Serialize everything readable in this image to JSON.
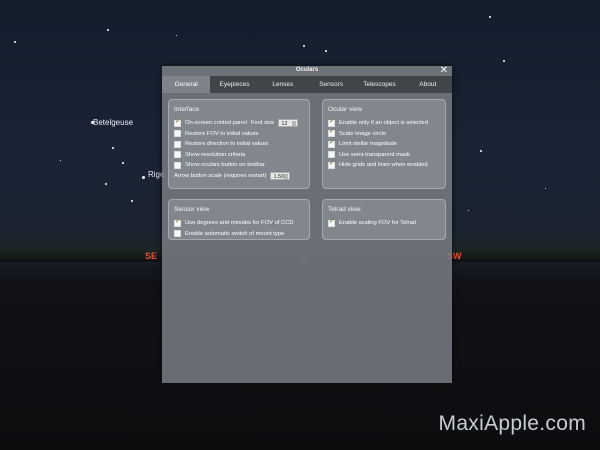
{
  "dialog": {
    "title": "Oculars",
    "close_glyph": "✕",
    "tabs": [
      "General",
      "Eyepieces",
      "Lenses",
      "Sensors",
      "Telescopes",
      "About"
    ],
    "active_tab": "General"
  },
  "interface": {
    "title": "Interface",
    "onscreen_label": "On-screen control panel",
    "font_size_label": "Font size",
    "font_size_value": "12",
    "items": [
      {
        "label": "On-screen control panel",
        "checked": true
      },
      {
        "label": "Restore FOV to initial values",
        "checked": false
      },
      {
        "label": "Restore direction to initial values",
        "checked": false
      },
      {
        "label": "Show resolution criteria",
        "checked": false
      },
      {
        "label": "Show oculars button on toolbar",
        "checked": false
      }
    ],
    "arrow_scale_label": "Arrow button scale (requires restart)",
    "arrow_scale_value": "1.50"
  },
  "ocular_view": {
    "title": "Ocular view",
    "items": [
      {
        "label": "Enable only if an object is selected",
        "checked": true
      },
      {
        "label": "Scale image circle",
        "checked": true
      },
      {
        "label": "Limit stellar magnitude",
        "checked": true
      },
      {
        "label": "Use semi-transparent mask",
        "checked": false
      },
      {
        "label": "Hide grids and lines when enabled",
        "checked": true
      }
    ]
  },
  "sensor_view": {
    "title": "Sensor view",
    "items": [
      {
        "label": "Use degrees and minutes for FOV of CCD",
        "checked": true
      },
      {
        "label": "Enable automatic switch of mount type",
        "checked": false
      }
    ]
  },
  "telrad_view": {
    "title": "Telrad view",
    "items": [
      {
        "label": "Enable scaling FOV for Telrad",
        "checked": true
      }
    ]
  },
  "sky": {
    "star_labels": [
      "Betelgeuse",
      "Rige"
    ],
    "cardinals": {
      "se": "SE",
      "s": "S",
      "sw": "SW"
    }
  },
  "watermark": "MaxiApple.com"
}
